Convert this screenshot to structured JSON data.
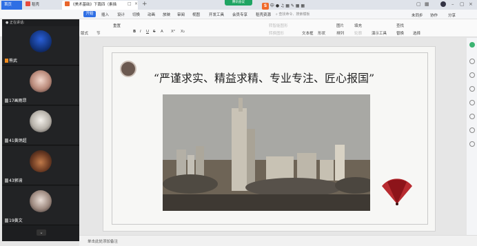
{
  "titlebar": {
    "tabs": [
      {
        "label": "首页",
        "active": false
      },
      {
        "label": "稻壳",
        "active": false
      },
      {
        "label": "《美术基础》下篇四（素描",
        "active": true
      }
    ],
    "meeting_chip": "腾讯会议",
    "ime_label": "中",
    "colors": {
      "home_tab": "#2f6fe4",
      "meeting": "#1fa463",
      "ime": "#f06a2a"
    }
  },
  "menubar": {
    "file_label": "三 文件",
    "start_label": "开始",
    "items": [
      "插入",
      "设计",
      "切换",
      "动画",
      "放映",
      "审阅",
      "视图",
      "开发工具",
      "会员专享",
      "稻壳资源"
    ],
    "search_placeholder": "查找命令、搜索模板",
    "share_labels": [
      "未同步",
      "协作",
      "分享"
    ]
  },
  "ribbon": {
    "left_labels": [
      "版式",
      "节",
      "重置"
    ],
    "font_row": [
      "B",
      "I",
      "U",
      "S",
      "A",
      "X²",
      "X₂"
    ],
    "right_labels": [
      "文本框",
      "形状",
      "排列",
      "图片",
      "填充",
      "轮廓",
      "演示工具",
      "查找",
      "替换",
      "选择"
    ],
    "text_tools": [
      "转智能图形",
      "对齐文本",
      "转换图形"
    ]
  },
  "video_panel": {
    "header": "正在讲话:",
    "participants": [
      {
        "name": "熊武"
      },
      {
        "name": "17画雨昂"
      },
      {
        "name": "41黄炳超"
      },
      {
        "name": "43郭渝"
      },
      {
        "name": "19黄文"
      }
    ]
  },
  "slide": {
    "headline": "“严谨求实、精益求精、专业专注、匠心报国”"
  },
  "statusbar": {
    "note_placeholder": "单击此处添加备注"
  }
}
